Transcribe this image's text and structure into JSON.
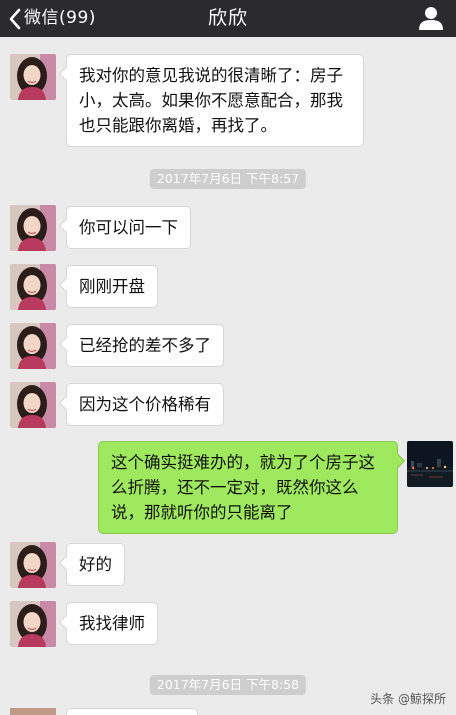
{
  "header": {
    "back_label": "微信(99)",
    "title": "欣欣"
  },
  "timestamps": [
    "2017年7月6日 下午8:57",
    "2017年7月6日 下午8:58"
  ],
  "messages": [
    {
      "side": "left",
      "text": "我对你的意见我说的很清晰了：房子小，太高。如果你不愿意配合，那我也只能跟你离婚，再找了。"
    },
    {
      "side": "left",
      "text": "你可以问一下"
    },
    {
      "side": "left",
      "text": "刚刚开盘"
    },
    {
      "side": "left",
      "text": "已经抢的差不多了"
    },
    {
      "side": "left",
      "text": "因为这个价格稀有"
    },
    {
      "side": "right",
      "text": "这个确实挺难办的，就为了个房子这么折腾，还不一定对，既然你这么说，那就听你的只能离了"
    },
    {
      "side": "left",
      "text": "好的"
    },
    {
      "side": "left",
      "text": "我找律师"
    }
  ],
  "watermark": "头条 @鲸探所",
  "colors": {
    "topbar": "#2b2b2f",
    "background": "#ebebeb",
    "sent_bubble": "#9fe95f",
    "received_bubble": "#ffffff",
    "timestamp_pill": "#cecece"
  }
}
